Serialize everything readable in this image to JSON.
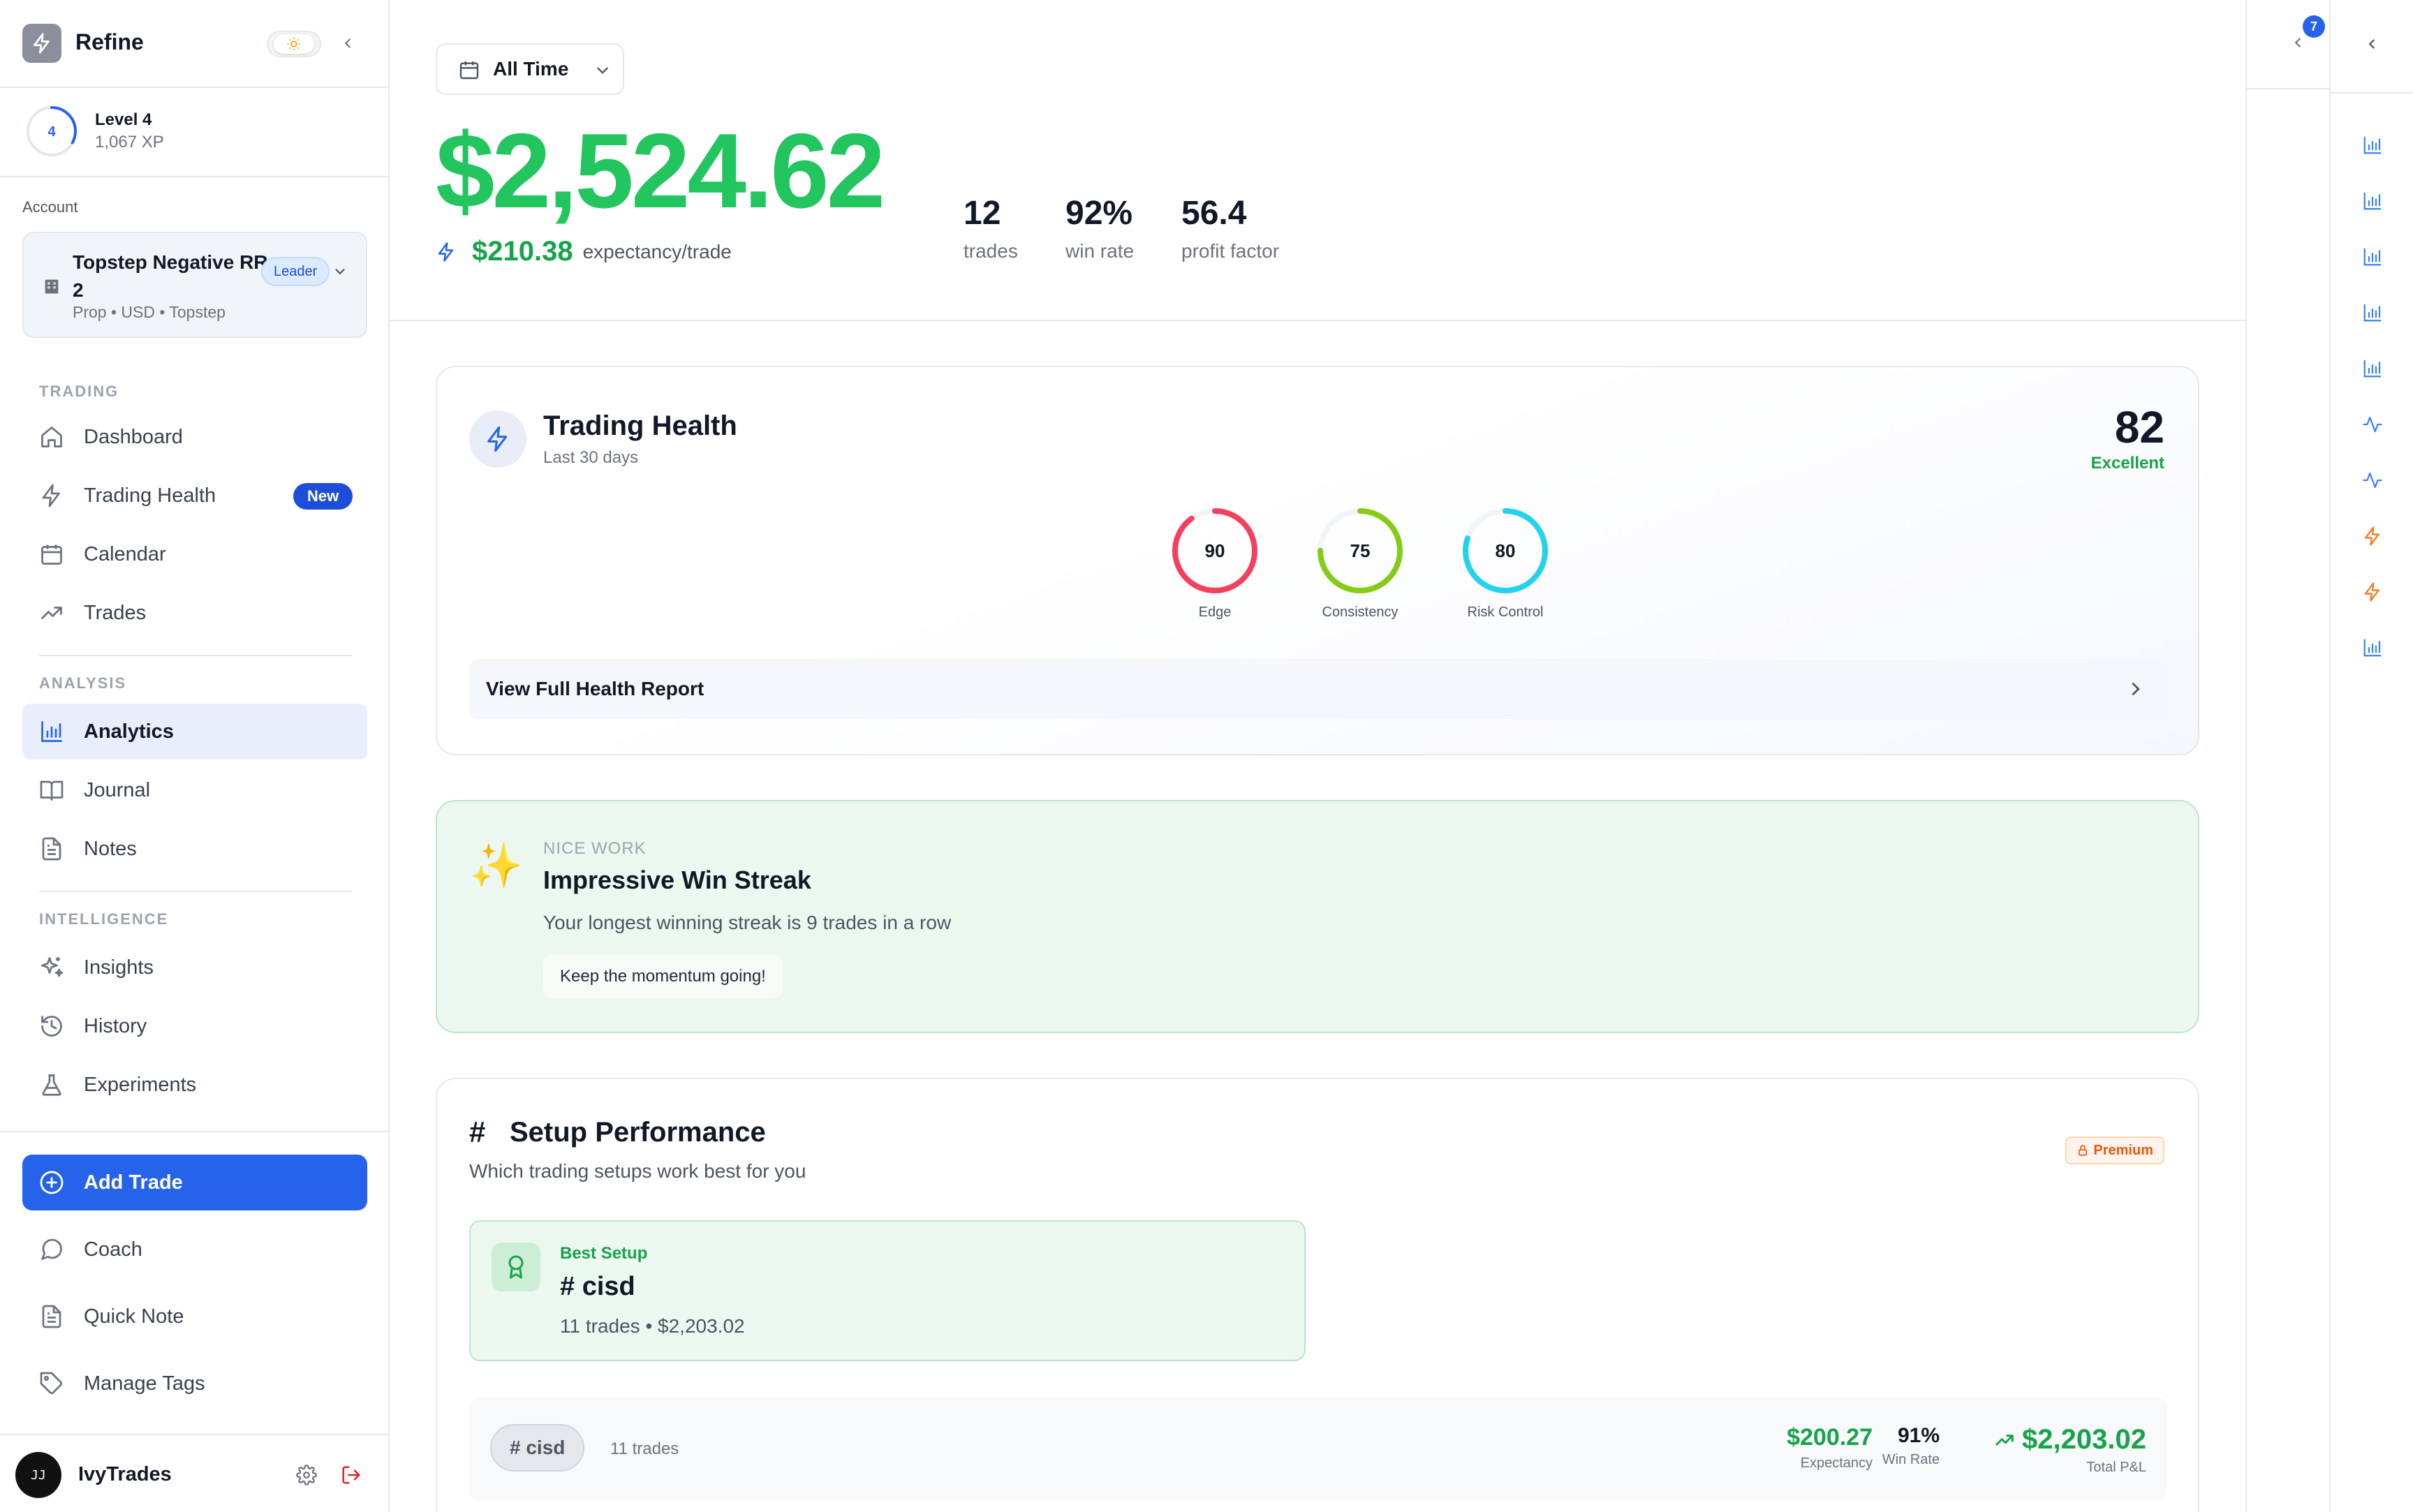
{
  "colors": {
    "accent": "#2563eb",
    "positive": "#22c55e",
    "positive_dark": "#16a34a",
    "warning": "#ea580c"
  },
  "brand": {
    "name": "Refine",
    "theme_icon": "sun-icon",
    "collapse_icon": "chevron-left-icon"
  },
  "level": {
    "number": "4",
    "title": "Level 4",
    "xp": "1,067 XP",
    "progress": 0.33
  },
  "account": {
    "label": "Account",
    "name": "Topstep Negative RR 2",
    "details": "Prop • USD • Topstep",
    "badge": "Leader"
  },
  "nav": {
    "trading_label": "TRADING",
    "trading": [
      {
        "label": "Dashboard",
        "icon": "home-icon"
      },
      {
        "label": "Trading Health",
        "icon": "zap-icon",
        "badge": "New"
      },
      {
        "label": "Calendar",
        "icon": "calendar-icon"
      },
      {
        "label": "Trades",
        "icon": "trending-up-icon"
      }
    ],
    "analysis_label": "ANALYSIS",
    "analysis": [
      {
        "label": "Analytics",
        "icon": "bar-chart-icon",
        "active": true
      },
      {
        "label": "Journal",
        "icon": "book-icon"
      },
      {
        "label": "Notes",
        "icon": "file-text-icon"
      }
    ],
    "intelligence_label": "INTELLIGENCE",
    "intelligence": [
      {
        "label": "Insights",
        "icon": "sparkles-icon"
      },
      {
        "label": "History",
        "icon": "history-icon"
      },
      {
        "label": "Experiments",
        "icon": "flask-icon"
      }
    ]
  },
  "actions": {
    "add_trade": "Add Trade",
    "coach": "Coach",
    "quick_note": "Quick Note",
    "manage_tags": "Manage Tags"
  },
  "user": {
    "name": "IvyTrades",
    "avatar_text": "JJ"
  },
  "header": {
    "time_range": "All Time",
    "total_pnl": "$2,524.62",
    "expectancy_value": "$210.38",
    "expectancy_label": "expectancy/trade",
    "stats": [
      {
        "value": "12",
        "label": "trades"
      },
      {
        "value": "92%",
        "label": "win rate"
      },
      {
        "value": "56.4",
        "label": "profit factor"
      }
    ]
  },
  "health": {
    "title": "Trading Health",
    "subtitle": "Last 30 days",
    "score": "82",
    "score_label": "Excellent",
    "gauges": [
      {
        "value": "90",
        "label": "Edge",
        "color": "#f43f5e",
        "fraction": 0.9
      },
      {
        "value": "75",
        "label": "Consistency",
        "color": "#84cc16",
        "fraction": 0.75
      },
      {
        "value": "80",
        "label": "Risk Control",
        "color": "#22d3ee",
        "fraction": 0.8
      }
    ],
    "link": "View Full Health Report"
  },
  "streak": {
    "eyebrow": "NICE WORK",
    "icon": "✨",
    "title": "Impressive Win Streak",
    "description": "Your longest winning streak is 9 trades in a row",
    "pill": "Keep the momentum going!"
  },
  "setup": {
    "hash": "#",
    "title": "Setup Performance",
    "subtitle": "Which trading setups work best for you",
    "premium": "Premium",
    "best_label": "Best Setup",
    "best_name": "# cisd",
    "best_meta": "11 trades • $2,203.02",
    "row": {
      "tag": "# cisd",
      "count": "11 trades",
      "expectancy_value": "$200.27",
      "expectancy_label": "Expectancy",
      "win_rate_value": "91%",
      "win_rate_label": "Win Rate",
      "total_value": "$2,203.02",
      "total_label": "Total P&L"
    }
  },
  "rail": {
    "notification_count": "7",
    "icons": [
      "bar-chart-icon",
      "bar-chart-icon",
      "bar-chart-icon",
      "bar-chart-icon",
      "bar-chart-icon",
      "activity-icon",
      "activity-icon",
      "zap-icon",
      "zap-icon",
      "bar-chart-icon"
    ]
  }
}
